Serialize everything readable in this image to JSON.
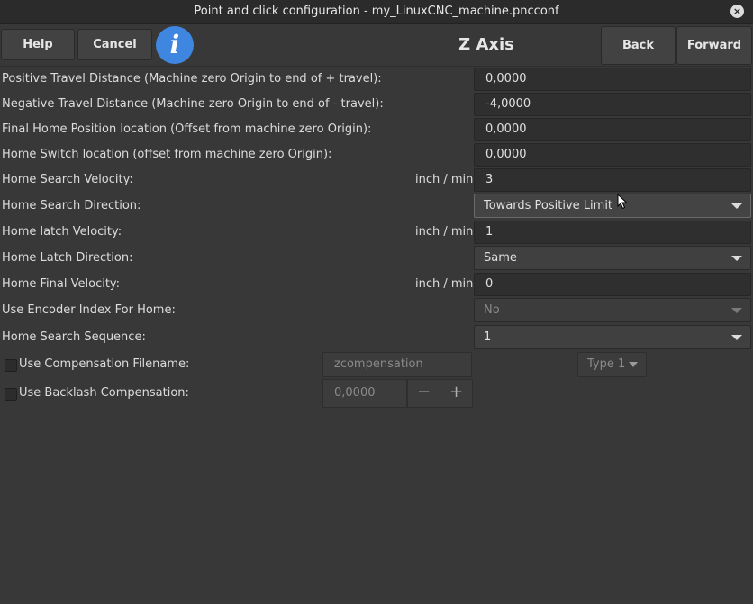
{
  "window": {
    "title": "Point and click configuration - my_LinuxCNC_machine.pncconf",
    "close_glyph": "×"
  },
  "header": {
    "help_label": "Help",
    "cancel_label": "Cancel",
    "info_glyph": "i",
    "title": "Z Axis",
    "back_label": "Back",
    "forward_label": "Forward"
  },
  "form": {
    "positive_travel": {
      "label": "Positive Travel Distance  (Machine zero Origin to end of + travel):",
      "value": "0,0000"
    },
    "negative_travel": {
      "label": "Negative Travel Distance  (Machine zero Origin to end of - travel):",
      "value": "-4,0000"
    },
    "final_home": {
      "label": "Final Home Position location   (Offset from machine zero Origin):",
      "value": "0,0000"
    },
    "home_switch": {
      "label": "Home Switch location   (offset from machine zero Origin):",
      "value": "0,0000"
    },
    "home_search_velocity": {
      "label": "Home Search Velocity:",
      "unit": "inch / min",
      "value": "3"
    },
    "home_search_direction": {
      "label": "Home Search Direction:",
      "value": "Towards Positive Limit"
    },
    "home_latch_velocity": {
      "label": "Home latch Velocity:",
      "unit": "inch / min",
      "value": "1"
    },
    "home_latch_direction": {
      "label": "Home Latch Direction:",
      "value": "Same"
    },
    "home_final_velocity": {
      "label": "Home Final Velocity:",
      "unit": "inch / min",
      "value": "0"
    },
    "use_encoder_index": {
      "label": "Use Encoder Index For Home:",
      "value": "No"
    },
    "home_search_sequence": {
      "label": "Home Search Sequence:",
      "value": "1"
    },
    "compensation": {
      "label": "Use Compensation Filename:",
      "placeholder": "zcompensation",
      "type_value": "Type 1"
    },
    "backlash": {
      "label": "Use Backlash Compensation:",
      "value": "0,0000",
      "minus": "−",
      "plus": "+"
    }
  }
}
